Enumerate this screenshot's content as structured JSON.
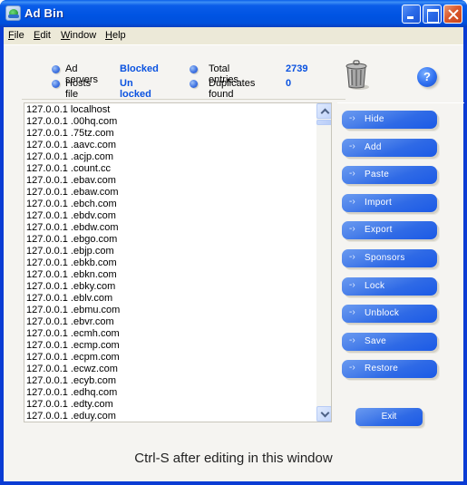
{
  "window": {
    "title": "Ad Bin",
    "controls": {
      "minimize": "minimize",
      "maximize": "maximize",
      "close": "close"
    }
  },
  "menu": [
    {
      "label": "File",
      "mnemonic": "F",
      "rest": "ile"
    },
    {
      "label": "Edit",
      "mnemonic": "E",
      "rest": "dit"
    },
    {
      "label": "Window",
      "mnemonic": "W",
      "rest": "indow"
    },
    {
      "label": "Help",
      "mnemonic": "H",
      "rest": "elp"
    }
  ],
  "status": {
    "ad_servers": {
      "label": "Ad servers",
      "value": "Blocked"
    },
    "hosts_file": {
      "label": "Hosts file",
      "value": "Un locked"
    },
    "total_entries": {
      "label": "Total entries",
      "value": "2739"
    },
    "duplicates": {
      "label": "Duplicates found",
      "value": "0"
    }
  },
  "icons": {
    "trash": "trash-bin-icon",
    "help": "?"
  },
  "hosts_list": [
    "127.0.0.1 localhost",
    "127.0.0.1 .00hq.com",
    "127.0.0.1 .75tz.com",
    "127.0.0.1 .aavc.com",
    "127.0.0.1 .acjp.com",
    "127.0.0.1 .count.cc",
    "127.0.0.1 .ebav.com",
    "127.0.0.1 .ebaw.com",
    "127.0.0.1 .ebch.com",
    "127.0.0.1 .ebdv.com",
    "127.0.0.1 .ebdw.com",
    "127.0.0.1 .ebgo.com",
    "127.0.0.1 .ebjp.com",
    "127.0.0.1 .ebkb.com",
    "127.0.0.1 .ebkn.com",
    "127.0.0.1 .ebky.com",
    "127.0.0.1 .eblv.com",
    "127.0.0.1 .ebmu.com",
    "127.0.0.1 .ebvr.com",
    "127.0.0.1 .ecmh.com",
    "127.0.0.1 .ecmp.com",
    "127.0.0.1 .ecpm.com",
    "127.0.0.1 .ecwz.com",
    "127.0.0.1 .ecyb.com",
    "127.0.0.1 .edhq.com",
    "127.0.0.1 .edty.com",
    "127.0.0.1 .eduy.com"
  ],
  "buttons": {
    "arrow": "-›",
    "hide": "Hide",
    "add": "Add",
    "paste": "Paste",
    "import": "Import",
    "export": "Export",
    "sponsors": "Sponsors",
    "lock": "Lock",
    "unblock": "Unblock",
    "save": "Save",
    "restore": "Restore",
    "exit": "Exit"
  },
  "footer": "Ctrl-S after editing in this window"
}
